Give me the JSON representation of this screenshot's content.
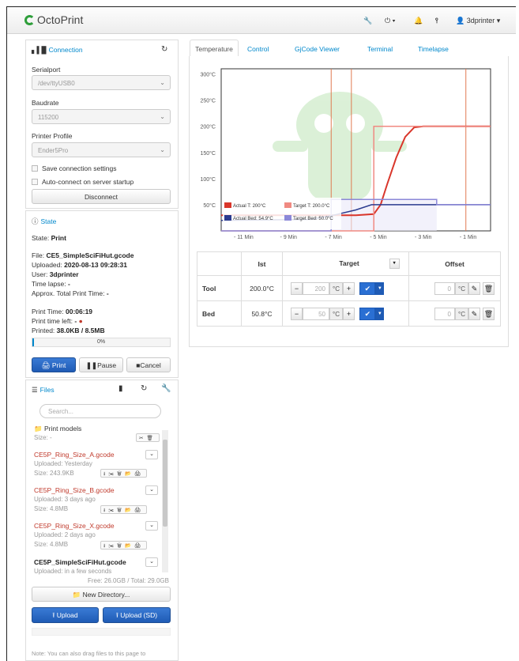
{
  "navbar": {
    "brand": "OctoPrint",
    "user": "3dprinter",
    "icons": [
      "wrench-icon",
      "power-icon",
      "bell-icon",
      "sliders-icon",
      "user-icon"
    ]
  },
  "connection": {
    "title": "Connection",
    "serialport_label": "Serialport",
    "serialport_value": "/dev/ttyUSB0",
    "baudrate_label": "Baudrate",
    "baudrate_value": "115200",
    "profile_label": "Printer Profile",
    "profile_value": "Ender5Pro",
    "save_label": "Save connection settings",
    "autoconnect_label": "Auto-connect on server startup",
    "disconnect_label": "Disconnect"
  },
  "state": {
    "title": "State",
    "state_label": "State:",
    "state_value": "Print",
    "file_label": "File:",
    "file_value": "CE5_SimpleSciFiHut.gcode",
    "uploaded_label": "Uploaded:",
    "uploaded_value": "2020-08-13 09:28:31",
    "user_label": "User:",
    "user_value": "3dprinter",
    "timelapse_label": "Time lapse:",
    "timelapse_value": "-",
    "approx_label": "Approx. Total Print Time:",
    "approx_value": "-",
    "printtime_label": "Print Time:",
    "printtime_value": "00:06:19",
    "timeleft_label": "Print time left:",
    "timeleft_value": "-",
    "printed_label": "Printed:",
    "printed_value": "38.0KB / 8.5MB",
    "progress_text": "0%",
    "progress_fraction": 0.0045,
    "print_label": "Print",
    "pause_label": "Pause",
    "cancel_label": "Cancel"
  },
  "files": {
    "title": "Files",
    "search_placeholder": "Search...",
    "folder_name": "Print models",
    "folder_size": "Size: -",
    "items": [
      {
        "name": "CE5P_Ring_Size_A.gcode",
        "uploaded": "Uploaded: Yesterday",
        "size": "Size: 243.9KB"
      },
      {
        "name": "CE5P_Ring_Size_B.gcode",
        "uploaded": "Uploaded: 3 days ago",
        "size": "Size: 4.8MB"
      },
      {
        "name": "CE5P_Ring_Size_X.gcode",
        "uploaded": "Uploaded: 2 days ago",
        "size": "Size: 4.8MB"
      },
      {
        "name": "CE5P_SimpleSciFiHut.gcode",
        "uploaded": "Uploaded: in a few seconds",
        "size": ""
      }
    ],
    "free_total": "Free: 26.0GB / Total: 29.0GB",
    "new_dir_label": "New Directory...",
    "upload_label": "Upload",
    "upload_sd_label": "Upload (SD)",
    "note": "Note: You can also drag files to this page to"
  },
  "tabs": [
    "Temperature",
    "Control",
    "GjCode Viewer",
    "Terminal",
    "Timelapse"
  ],
  "chart_data": {
    "type": "line",
    "title": "",
    "xlabel": "",
    "ylabel": "",
    "x_ticks": [
      "- 11 Min",
      "- 9 Min",
      "- 7 Min",
      "- 5 Min",
      "- 3 Min",
      "- 1 Min"
    ],
    "y_ticks": [
      "50°C",
      "100°C",
      "150°C",
      "200°C",
      "250°C",
      "300°C"
    ],
    "xlim": [
      -12,
      0
    ],
    "ylim": [
      0,
      310
    ],
    "series": [
      {
        "name": "Actual T: 200°C",
        "color": "#d9362b",
        "x": [
          -12,
          -6,
          -5.2,
          -4.9,
          -4.6,
          -4.2,
          -3.8,
          -3.4,
          -3.0,
          -2.5,
          0
        ],
        "y": [
          30,
          30,
          32,
          50,
          90,
          140,
          180,
          198,
          200,
          200,
          200
        ]
      },
      {
        "name": "Target T: 200.0°C",
        "color": "#f08a82",
        "x": [
          -12,
          -6.3,
          -5.2,
          -5.2,
          0
        ],
        "y": [
          0,
          0,
          0,
          200,
          200
        ]
      },
      {
        "name": "Actual Bed: 54.9°C",
        "color": "#2b3b8f",
        "x": [
          -12,
          -8,
          -7,
          -6,
          -5.3,
          -4.8,
          -3,
          -2.5,
          0
        ],
        "y": [
          20,
          22,
          30,
          40,
          50,
          50,
          50,
          50,
          50
        ]
      },
      {
        "name": "Target Bed: 50.0°C",
        "color": "#8c88d8",
        "x": [
          -12,
          -7.1,
          -7.1,
          -2.4,
          -2.4,
          0
        ],
        "y": [
          0,
          0,
          60,
          60,
          50,
          50
        ]
      }
    ],
    "vlines": [
      -7.1,
      -6.2,
      -1.1
    ],
    "legend": "bottom-left",
    "grid": false
  },
  "temp_table": {
    "col_ist": "Ist",
    "col_target": "Target",
    "col_offset": "Offset",
    "unit": "°C",
    "rows": [
      {
        "name": "Tool",
        "actual": "200.0°C",
        "target": "200",
        "offset": "0"
      },
      {
        "name": "Bed",
        "actual": "50.8°C",
        "target": "50",
        "offset": "0"
      }
    ]
  }
}
